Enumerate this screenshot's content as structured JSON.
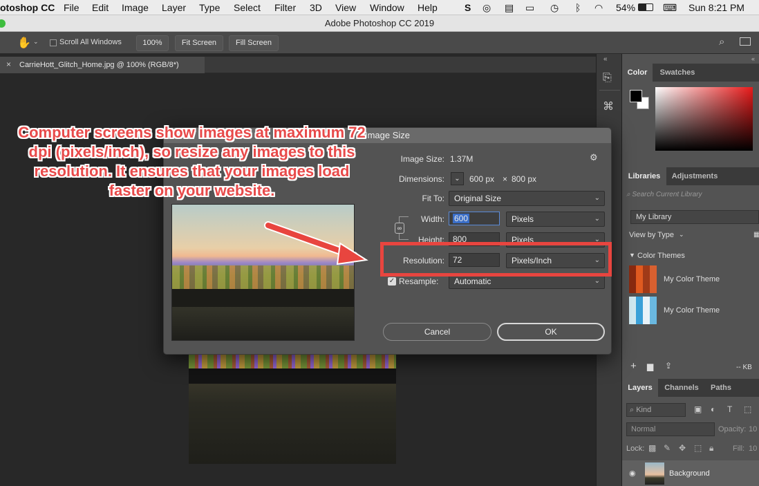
{
  "menubar": {
    "app_name": "otoshop CC",
    "items": [
      "File",
      "Edit",
      "Image",
      "Layer",
      "Type",
      "Select",
      "Filter",
      "3D",
      "View",
      "Window",
      "Help"
    ],
    "battery": "54%",
    "clock": "Sun 8:21 PM"
  },
  "window": {
    "title": "Adobe Photoshop CC 2019"
  },
  "options": {
    "scroll_all": "Scroll All Windows",
    "zoom_100": "100%",
    "fit_screen": "Fit Screen",
    "fill_screen": "Fill Screen"
  },
  "document": {
    "tab_label": "CarrieHott_Glitch_Home.jpg @ 100% (RGB/8*)"
  },
  "dialog": {
    "title": "Image Size",
    "image_size_label": "Image Size:",
    "image_size_value": "1.37M",
    "dimensions_label": "Dimensions:",
    "dim_width": "600 px",
    "dim_times": "×",
    "dim_height": "800 px",
    "fit_to_label": "Fit To:",
    "fit_to_value": "Original Size",
    "width_label": "Width:",
    "width_value": "600",
    "width_unit": "Pixels",
    "height_label": "Height:",
    "height_value": "800",
    "height_unit": "Pixels",
    "resolution_label": "Resolution:",
    "resolution_value": "72",
    "resolution_unit": "Pixels/Inch",
    "resample_label": "Resample:",
    "resample_value": "Automatic",
    "cancel": "Cancel",
    "ok": "OK"
  },
  "annotation": {
    "text": "Computer screens show images at maximum 72 dpi (pixels/inch), so resize any images to this resolution. It ensures that your images load faster on your website.",
    "color": "#e84a4a"
  },
  "panels": {
    "color_tab": "Color",
    "swatches_tab": "Swatches",
    "libraries_tab": "Libraries",
    "adjustments_tab": "Adjustments",
    "search_placeholder": "Search Current Library",
    "library_name": "My Library",
    "view_by": "View by Type",
    "color_themes": "Color Themes",
    "theme1": "My Color Theme",
    "theme2": "My Color Theme",
    "kb": "-- KB",
    "layers_tab": "Layers",
    "channels_tab": "Channels",
    "paths_tab": "Paths",
    "kind_filter": "Kind",
    "blend_mode": "Normal",
    "opacity_label": "Opacity:",
    "opacity_value": "10",
    "lock_label": "Lock:",
    "fill_label": "Fill:",
    "fill_value": "10",
    "layer_name": "Background"
  }
}
